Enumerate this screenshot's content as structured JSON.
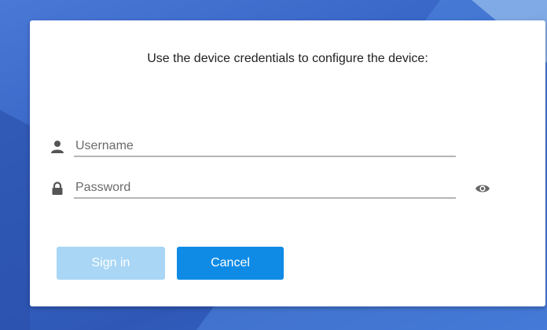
{
  "dialog": {
    "instruction": "Use the device credentials to configure the device:",
    "username": {
      "placeholder": "Username",
      "value": "",
      "icon": "user-icon"
    },
    "password": {
      "placeholder": "Password",
      "value": "",
      "icon": "lock-icon",
      "toggle_icon": "eye-icon"
    },
    "buttons": {
      "sign_in": "Sign in",
      "cancel": "Cancel"
    }
  },
  "colors": {
    "primary": "#0f8be6",
    "disabled_primary": "#a9d6f5",
    "background_blue": "#3563c4"
  }
}
